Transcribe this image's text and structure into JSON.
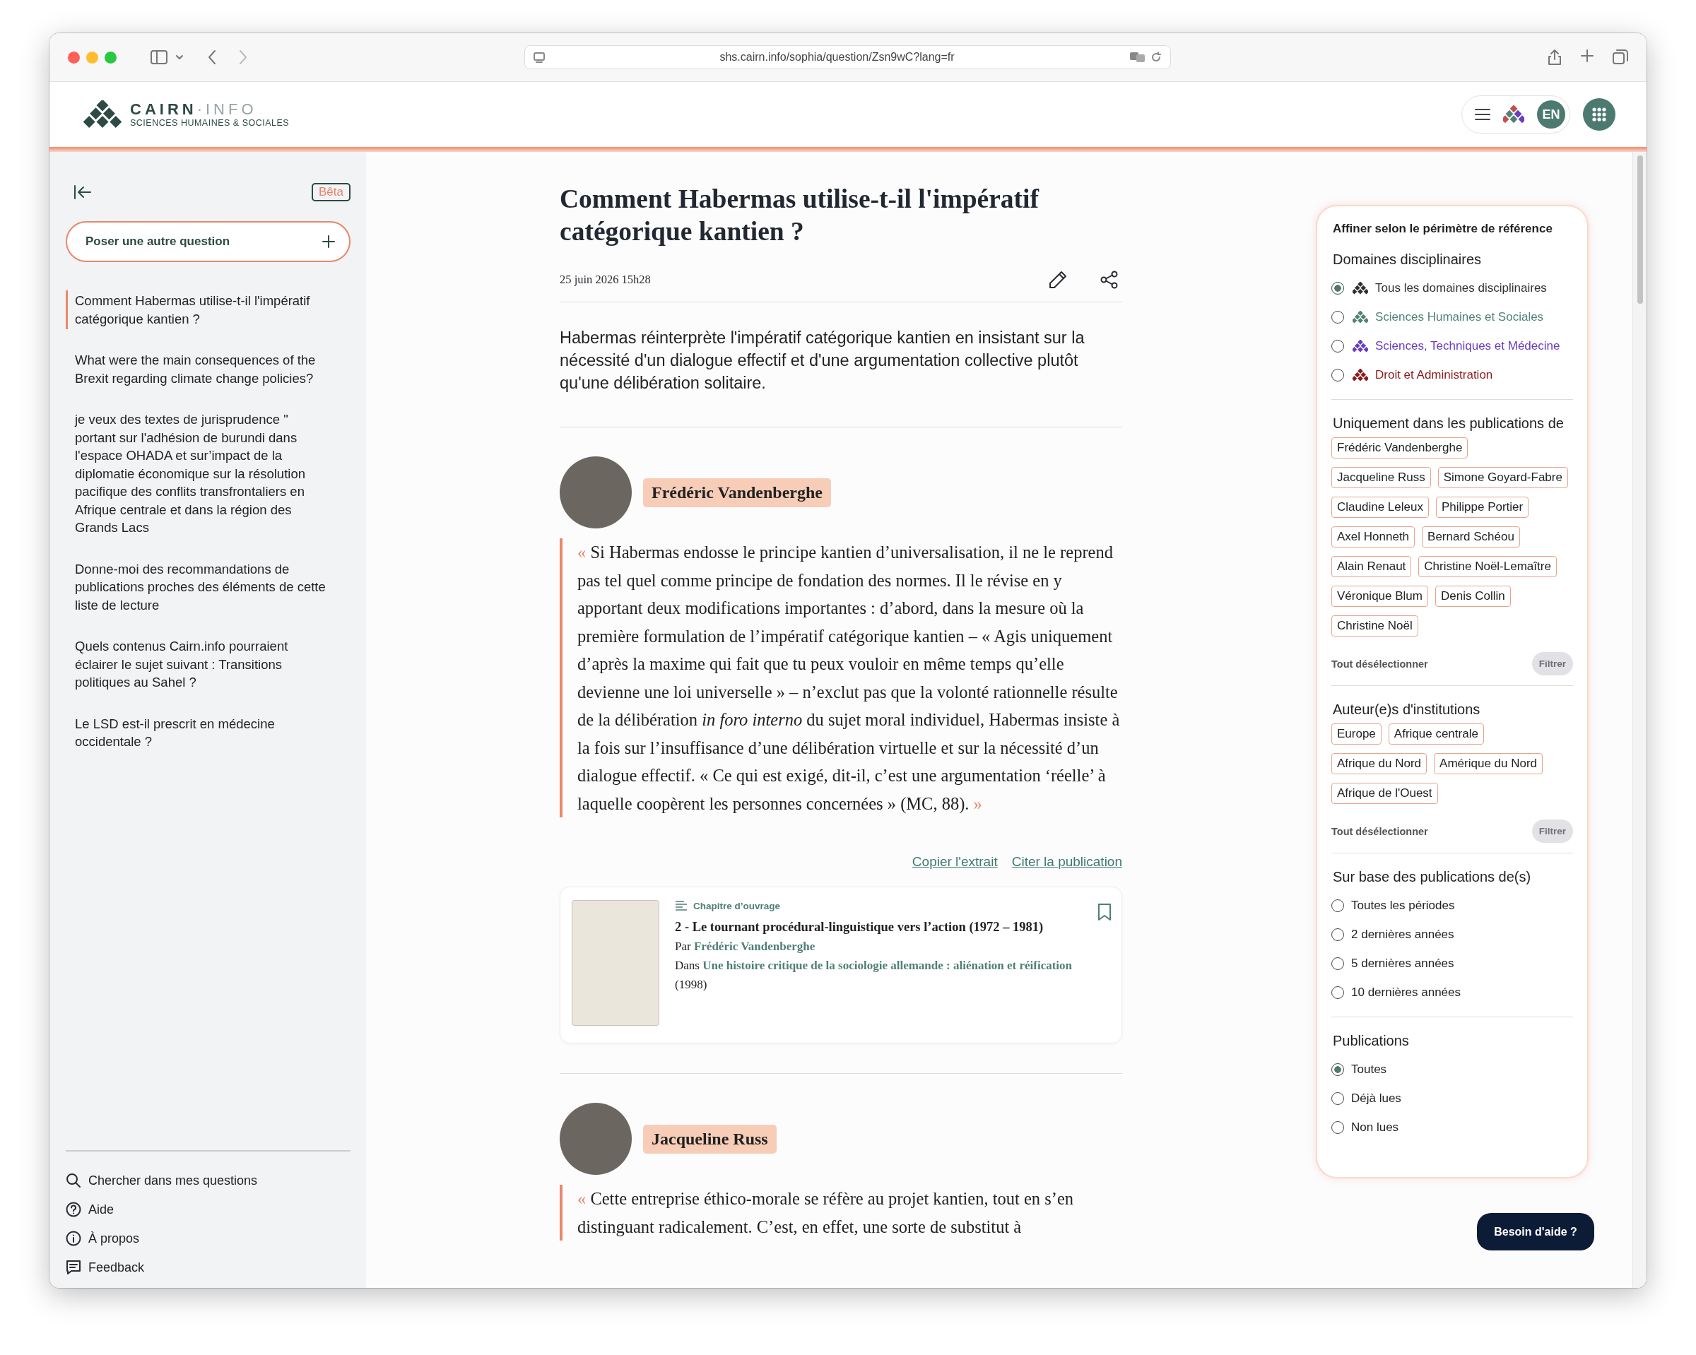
{
  "browser": {
    "url": "shs.cairn.info/sophia/question/Zsn9wC?lang=fr"
  },
  "header": {
    "logo": {
      "name": "CAIRN",
      "suffix": "·INFO",
      "tagline": "SCIENCES HUMAINES & SOCIALES"
    },
    "language": "EN"
  },
  "sidebar": {
    "badge": "Bêta",
    "new_question": "Poser une autre question",
    "history": [
      {
        "text": "Comment Habermas utilise-t-il l'impératif catégorique kantien ?",
        "selected": true
      },
      {
        "text": "What were the main consequences of the Brexit regarding climate change policies?",
        "selected": false
      },
      {
        "text": "je veux des textes de jurisprudence \" portant sur l'adhésion de burundi dans l'espace OHADA et sur’impact de la diplomatie économique sur la résolution pacifique des conflits transfrontaliers en Afrique centrale et dans la région des Grands Lacs",
        "selected": false
      },
      {
        "text": "Donne-moi des recommandations de publications proches des éléments de cette liste de lecture",
        "selected": false
      },
      {
        "text": "Quels contenus Cairn.info pourraient éclairer le sujet suivant : Transitions politiques au Sahel ?",
        "selected": false
      },
      {
        "text": "Le LSD est-il prescrit en médecine occidentale ?",
        "selected": false
      }
    ],
    "footer_links": [
      {
        "kind": "search",
        "label": "Chercher dans mes questions"
      },
      {
        "kind": "help",
        "label": "Aide"
      },
      {
        "kind": "info",
        "label": "À propos"
      },
      {
        "kind": "feedback",
        "label": "Feedback"
      }
    ]
  },
  "question": {
    "title": "Comment Habermas utilise-t-il l'impératif catégorique kantien ?",
    "date": "25 juin 2026 15h28",
    "summary": "Habermas réinterprète l'impératif catégorique kantien en insistant sur la nécessité d'un dialogue effectif et d'une argumentation collective plutôt qu'une délibération solitaire."
  },
  "answers": [
    {
      "author": "Frédéric Vandenberghe",
      "quote": {
        "open": "«",
        "text": "Si Habermas endosse le principe kantien d’universalisation, il ne le reprend pas tel quel comme principe de fondation des normes. Il le révise en y apportant deux modifications importantes : d’abord, dans la mesure où la première formulation de l’impératif catégorique kantien – « Agis uniquement d’après la maxime qui fait que tu peux vouloir en même temps qu’elle devienne une loi universelle » – n’exclut pas que la volonté rationnelle résulte de la délibération *in foro interno* du sujet moral individuel, Habermas insiste à la fois sur l’insuffisance d’une délibération virtuelle et sur la nécessité d’un dialogue effectif. « Ce qui est exigé, dit-il, c’est une argumentation ‘réelle’ à laquelle coopèrent les personnes concernées » (MC, 88).",
        "close": "»"
      },
      "actions": [
        "Copier l'extrait",
        "Citer la publication"
      ],
      "publication": {
        "type": "Chapitre d’ouvrage",
        "title": "2 - Le tournant procédural-linguistique vers l’action (1972 – 1981)",
        "by_label": "Par",
        "author": "Frédéric Vandenberghe",
        "in_label": "Dans",
        "source": "Une histoire critique de la sociologie allemande : aliénation et réification",
        "year": "(1998)",
        "bookmarked": false
      }
    },
    {
      "author": "Jacqueline Russ",
      "quote": {
        "open": "«",
        "text": "Cette entreprise éthico-morale se réfère au projet kantien, tout en s’en distinguant radicalement. C’est, en effet, une sorte de substitut à"
      }
    }
  ],
  "filters": {
    "title": "Affiner selon le périmètre de référence",
    "sections": [
      {
        "kind": "radio",
        "heading": "Domaines disciplinaires",
        "options": [
          {
            "label": "Tous les domaines disciplinaires",
            "color": "#2f3034",
            "selected": true
          },
          {
            "label": "Sciences Humaines et Sociales",
            "color": "#4f8277",
            "selected": false
          },
          {
            "label": "Sciences, Techniques et Médecine",
            "color": "#6a3cc0",
            "selected": false
          },
          {
            "label": "Droit et Administration",
            "color": "#8e1a1a",
            "selected": false
          }
        ]
      },
      {
        "kind": "chips",
        "heading": "Uniquement dans les publications de",
        "chips": [
          {
            "label": "Frédéric Vandenberghe",
            "selected": false
          },
          {
            "label": "Jacqueline Russ",
            "selected": false
          },
          {
            "label": "Simone Goyard-Fabre",
            "selected": false
          },
          {
            "label": "Claudine Leleux",
            "selected": false
          },
          {
            "label": "Philippe Portier",
            "selected": false
          },
          {
            "label": "Axel Honneth",
            "selected": false
          },
          {
            "label": "Bernard Schéou",
            "selected": false
          },
          {
            "label": "Alain Renaut",
            "selected": false
          },
          {
            "label": "Christine Noël-Lemaître",
            "selected": false
          },
          {
            "label": "Véronique Blum",
            "selected": false
          },
          {
            "label": "Denis Collin",
            "selected": false
          },
          {
            "label": "Christine Noël",
            "selected": false
          }
        ],
        "clear": "Tout désélectionner",
        "apply": {
          "label": "Filtrer",
          "disabled": true
        }
      },
      {
        "kind": "chips",
        "heading": "Auteur(e)s d'institutions",
        "chips": [
          {
            "label": "Europe",
            "selected": false
          },
          {
            "label": "Afrique centrale",
            "selected": false
          },
          {
            "label": "Afrique du Nord",
            "selected": false
          },
          {
            "label": "Amérique du Nord",
            "selected": false
          },
          {
            "label": "Afrique de l'Ouest",
            "selected": false
          }
        ],
        "clear": "Tout désélectionner",
        "apply": {
          "label": "Filtrer",
          "disabled": true
        }
      },
      {
        "kind": "radio",
        "heading": "Sur base des publications de(s)",
        "options": [
          {
            "label": "Toutes les périodes",
            "selected": false
          },
          {
            "label": "2 dernières années",
            "selected": false
          },
          {
            "label": "5 dernières années",
            "selected": false
          },
          {
            "label": "10 dernières années",
            "selected": false
          }
        ]
      },
      {
        "kind": "radio",
        "heading": "Publications",
        "options": [
          {
            "label": "Toutes",
            "selected": true
          },
          {
            "label": "Déjà lues",
            "selected": false
          },
          {
            "label": "Non lues",
            "selected": false
          }
        ]
      }
    ]
  },
  "help_button": "Besoin d'aide ?"
}
